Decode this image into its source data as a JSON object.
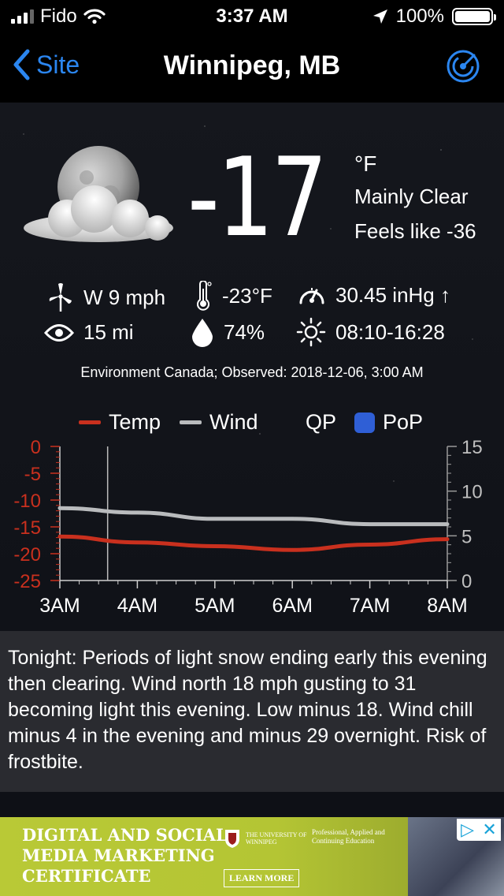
{
  "status_bar": {
    "carrier": "Fido",
    "time": "3:37 AM",
    "battery": "100%"
  },
  "nav": {
    "back_label": "Site",
    "title": "Winnipeg, MB"
  },
  "current": {
    "temperature": "-17",
    "unit": "°F",
    "condition": "Mainly Clear",
    "feels_like": "Feels like -36"
  },
  "observations": {
    "wind": "W 9 mph",
    "low_temp": "-23°F",
    "pressure": "30.45 inHg ↑",
    "visibility": "15 mi",
    "humidity": "74%",
    "sun": "08:10-16:28"
  },
  "observed_line": "Environment Canada; Observed: 2018-12-06, 3:00 AM",
  "legend": {
    "temp": "Temp",
    "wind": "Wind",
    "qp": "QP",
    "pop": "PoP"
  },
  "colors": {
    "temp": "#c9301e",
    "wind": "#b9bbbd",
    "pop": "#2f5fd6",
    "accent": "#2b86f0"
  },
  "chart_data": {
    "type": "line",
    "x": [
      "3AM",
      "4AM",
      "5AM",
      "6AM",
      "7AM",
      "8AM"
    ],
    "series": [
      {
        "name": "Temp",
        "axis": "left",
        "values": [
          -16.8,
          -17.9,
          -18.6,
          -19.3,
          -18.3,
          -17.3
        ]
      },
      {
        "name": "Wind",
        "axis": "right",
        "values": [
          8.1,
          7.6,
          6.9,
          6.9,
          6.3,
          6.3
        ]
      }
    ],
    "y_left": {
      "ticks": [
        "0",
        "-5",
        "-10",
        "-15",
        "-20",
        "-25"
      ],
      "range": [
        -25,
        0
      ]
    },
    "y_right": {
      "ticks": [
        "15",
        "10",
        "5",
        "0"
      ],
      "range": [
        0,
        15
      ]
    },
    "current_marker_x": "3:37AM"
  },
  "forecast_text": "Tonight:  Periods of light snow ending early this evening then clearing. Wind north 18 mph gusting to 31 becoming light this evening. Low minus 18. Wind chill minus 4 in the evening and minus 29 overnight. Risk of frostbite.",
  "ad": {
    "line1": "DIGITAL AND SOCIAL",
    "line2": "MEDIA MARKETING",
    "line3": "CERTIFICATE",
    "org": "THE UNIVERSITY OF WINNIPEG",
    "division": "Professional, Applied and Continuing Education",
    "cta": "LEARN MORE"
  }
}
